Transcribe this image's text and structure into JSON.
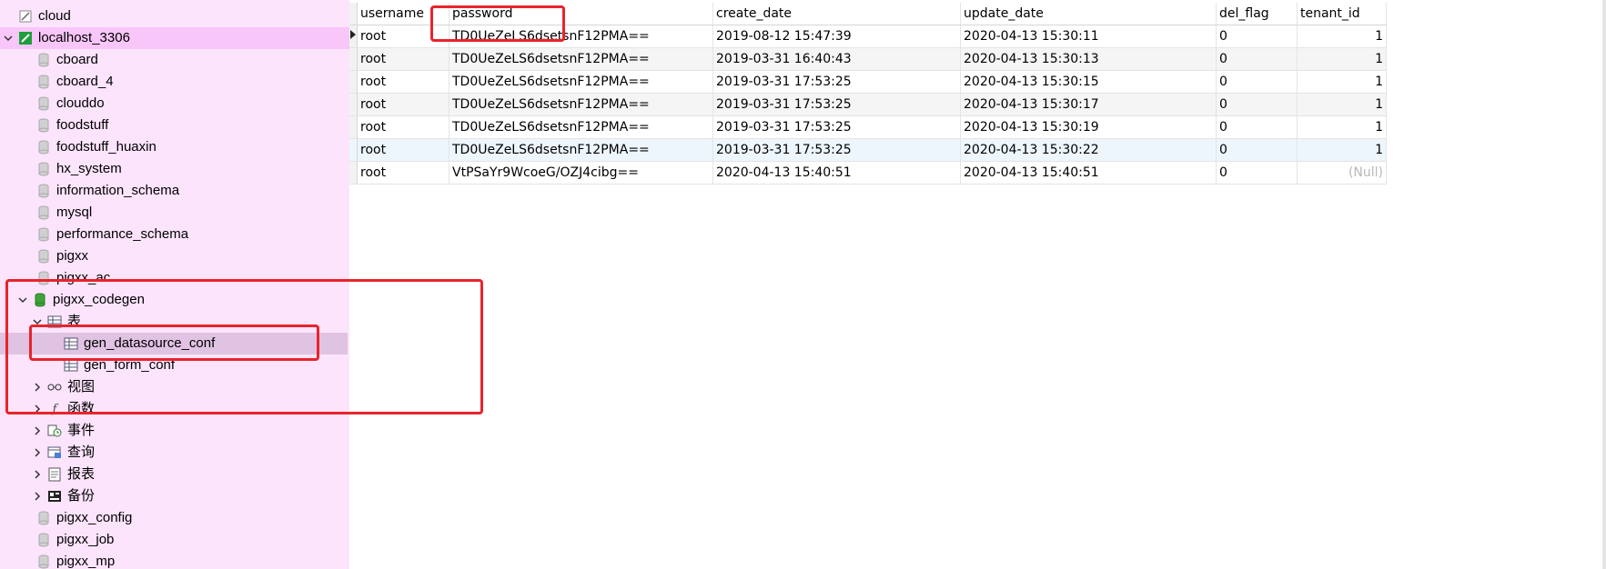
{
  "sidebar": {
    "items": [
      {
        "label": "cloud"
      },
      {
        "label": "localhost_3306"
      },
      {
        "label": "cboard"
      },
      {
        "label": "cboard_4"
      },
      {
        "label": "clouddo"
      },
      {
        "label": "foodstuff"
      },
      {
        "label": "foodstuff_huaxin"
      },
      {
        "label": "hx_system"
      },
      {
        "label": "information_schema"
      },
      {
        "label": "mysql"
      },
      {
        "label": "performance_schema"
      },
      {
        "label": "pigxx"
      },
      {
        "label": "pigxx_ac"
      },
      {
        "label": "pigxx_codegen"
      },
      {
        "label": "表"
      },
      {
        "label": "gen_datasource_conf"
      },
      {
        "label": "gen_form_conf"
      },
      {
        "label": "视图"
      },
      {
        "label": "函数"
      },
      {
        "label": "事件"
      },
      {
        "label": "查询"
      },
      {
        "label": "报表"
      },
      {
        "label": "备份"
      },
      {
        "label": "pigxx_config"
      },
      {
        "label": "pigxx_job"
      },
      {
        "label": "pigxx_mp"
      }
    ]
  },
  "grid": {
    "columns": [
      "username",
      "password",
      "create_date",
      "update_date",
      "del_flag",
      "tenant_id"
    ],
    "rows": [
      [
        "root",
        "TD0UeZeLS6dsetsnF12PMA==",
        "2019-08-12 15:47:39",
        "2020-04-13 15:30:11",
        "0",
        "1"
      ],
      [
        "root",
        "TD0UeZeLS6dsetsnF12PMA==",
        "2019-03-31 16:40:43",
        "2020-04-13 15:30:13",
        "0",
        "1"
      ],
      [
        "root",
        "TD0UeZeLS6dsetsnF12PMA==",
        "2019-03-31 17:53:25",
        "2020-04-13 15:30:15",
        "0",
        "1"
      ],
      [
        "root",
        "TD0UeZeLS6dsetsnF12PMA==",
        "2019-03-31 17:53:25",
        "2020-04-13 15:30:17",
        "0",
        "1"
      ],
      [
        "root",
        "TD0UeZeLS6dsetsnF12PMA==",
        "2019-03-31 17:53:25",
        "2020-04-13 15:30:19",
        "0",
        "1"
      ],
      [
        "root",
        "TD0UeZeLS6dsetsnF12PMA==",
        "2019-03-31 17:53:25",
        "2020-04-13 15:30:22",
        "0",
        "1"
      ],
      [
        "root",
        "VtPSaYr9WcoeG/OZJ4cibg==",
        "2020-04-13 15:40:51",
        "2020-04-13 15:40:51",
        "0",
        "(Null)"
      ]
    ]
  },
  "colors": {
    "sidebar_bg": "#fce4fc",
    "connection_row_bg": "#f8c6f8",
    "selected_row_bg": "#e0c2e3",
    "highlight_red": "#e8242b",
    "db_icon_green": "#3fa33a",
    "null_text": "#b8b8b8"
  },
  "icons": {
    "group": "folder-icon",
    "connection": "mysql-connection-icon",
    "database": "database-icon",
    "table": "table-icon",
    "view": "view-icon",
    "function": "function-icon",
    "event": "event-icon",
    "query": "query-icon",
    "report": "report-icon",
    "backup": "backup-icon"
  }
}
